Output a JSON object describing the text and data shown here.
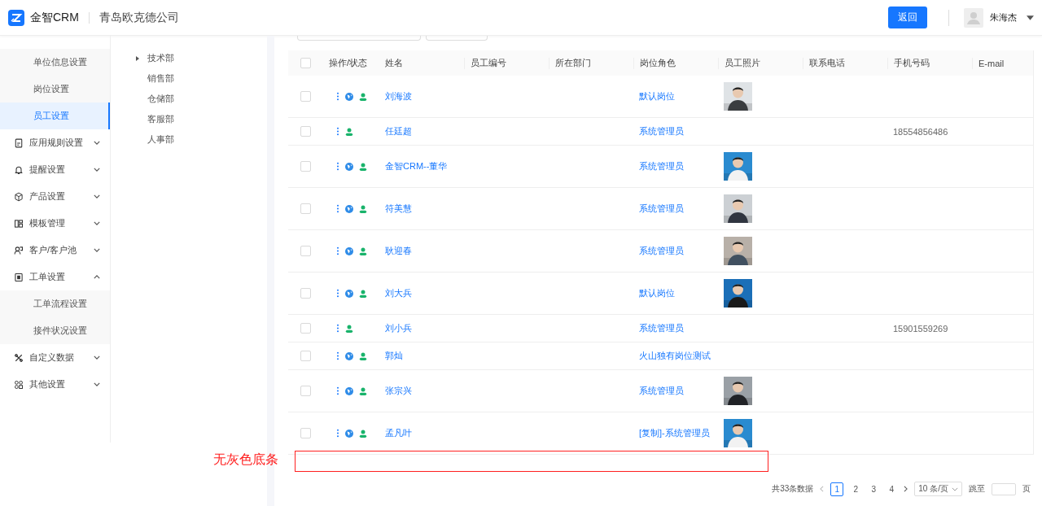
{
  "header": {
    "brand": "金智CRM",
    "company": "青岛欧克德公司",
    "back_button": "返回",
    "user": "朱海杰"
  },
  "sidebar": {
    "sub_items": [
      {
        "label": "单位信息设置",
        "selected": false
      },
      {
        "label": "岗位设置",
        "selected": false
      },
      {
        "label": "员工设置",
        "selected": true
      }
    ],
    "groups": [
      {
        "label": "应用规则设置",
        "expanded": false
      },
      {
        "label": "提醒设置",
        "expanded": false
      },
      {
        "label": "产品设置",
        "expanded": false
      },
      {
        "label": "模板管理",
        "expanded": false
      },
      {
        "label": "客户/客户池",
        "expanded": false
      },
      {
        "label": "工单设置",
        "expanded": true,
        "children": [
          {
            "label": "工单流程设置",
            "selected": false
          },
          {
            "label": "接件状况设置",
            "selected": false
          }
        ]
      },
      {
        "label": "自定义数据",
        "expanded": false
      },
      {
        "label": "其他设置",
        "expanded": false
      }
    ]
  },
  "departments": [
    {
      "label": "技术部",
      "expandable": true
    },
    {
      "label": "销售部",
      "expandable": false
    },
    {
      "label": "仓储部",
      "expandable": false
    },
    {
      "label": "客服部",
      "expandable": false
    },
    {
      "label": "人事部",
      "expandable": false
    }
  ],
  "table": {
    "header_checked": false,
    "columns": [
      "操作/状态",
      "姓名",
      "员工编号",
      "所在部门",
      "岗位角色",
      "员工照片",
      "联系电话",
      "手机号码",
      "E-mail"
    ],
    "rows": [
      {
        "checked": false,
        "linked": true,
        "name": "刘海波",
        "role": "默认岗位"
      },
      {
        "checked": false,
        "linked": false,
        "name": "任廷超",
        "role": "系统管理员",
        "mobile": "18554856486"
      },
      {
        "checked": false,
        "linked": true,
        "name": "金智CRM--董华",
        "role": "系统管理员"
      },
      {
        "checked": false,
        "linked": true,
        "name": "符美慧",
        "role": "系统管理员"
      },
      {
        "checked": false,
        "linked": true,
        "name": "耿迎春",
        "role": "系统管理员"
      },
      {
        "checked": false,
        "linked": true,
        "name": "刘大兵",
        "role": "默认岗位"
      },
      {
        "checked": false,
        "linked": false,
        "name": "刘小兵",
        "role": "系统管理员",
        "mobile": "15901559269"
      },
      {
        "checked": false,
        "linked": true,
        "name": "郭灿",
        "role": "火山独有岗位测试"
      },
      {
        "checked": false,
        "linked": true,
        "name": "张宗兴",
        "role": "系统管理员"
      },
      {
        "checked": false,
        "linked": true,
        "name": "孟凡叶",
        "role": "[复制]-系统管理员"
      }
    ]
  },
  "pagination": {
    "total": "共33条数据",
    "pages": [
      {
        "label": "1",
        "selected": true
      },
      {
        "label": "2",
        "selected": false
      },
      {
        "label": "3",
        "selected": false
      },
      {
        "label": "4",
        "selected": false
      }
    ],
    "page_size": "10 条/页",
    "jump_label": "跳至",
    "page_unit": "页"
  },
  "annotation": {
    "text": "无灰色底条"
  }
}
